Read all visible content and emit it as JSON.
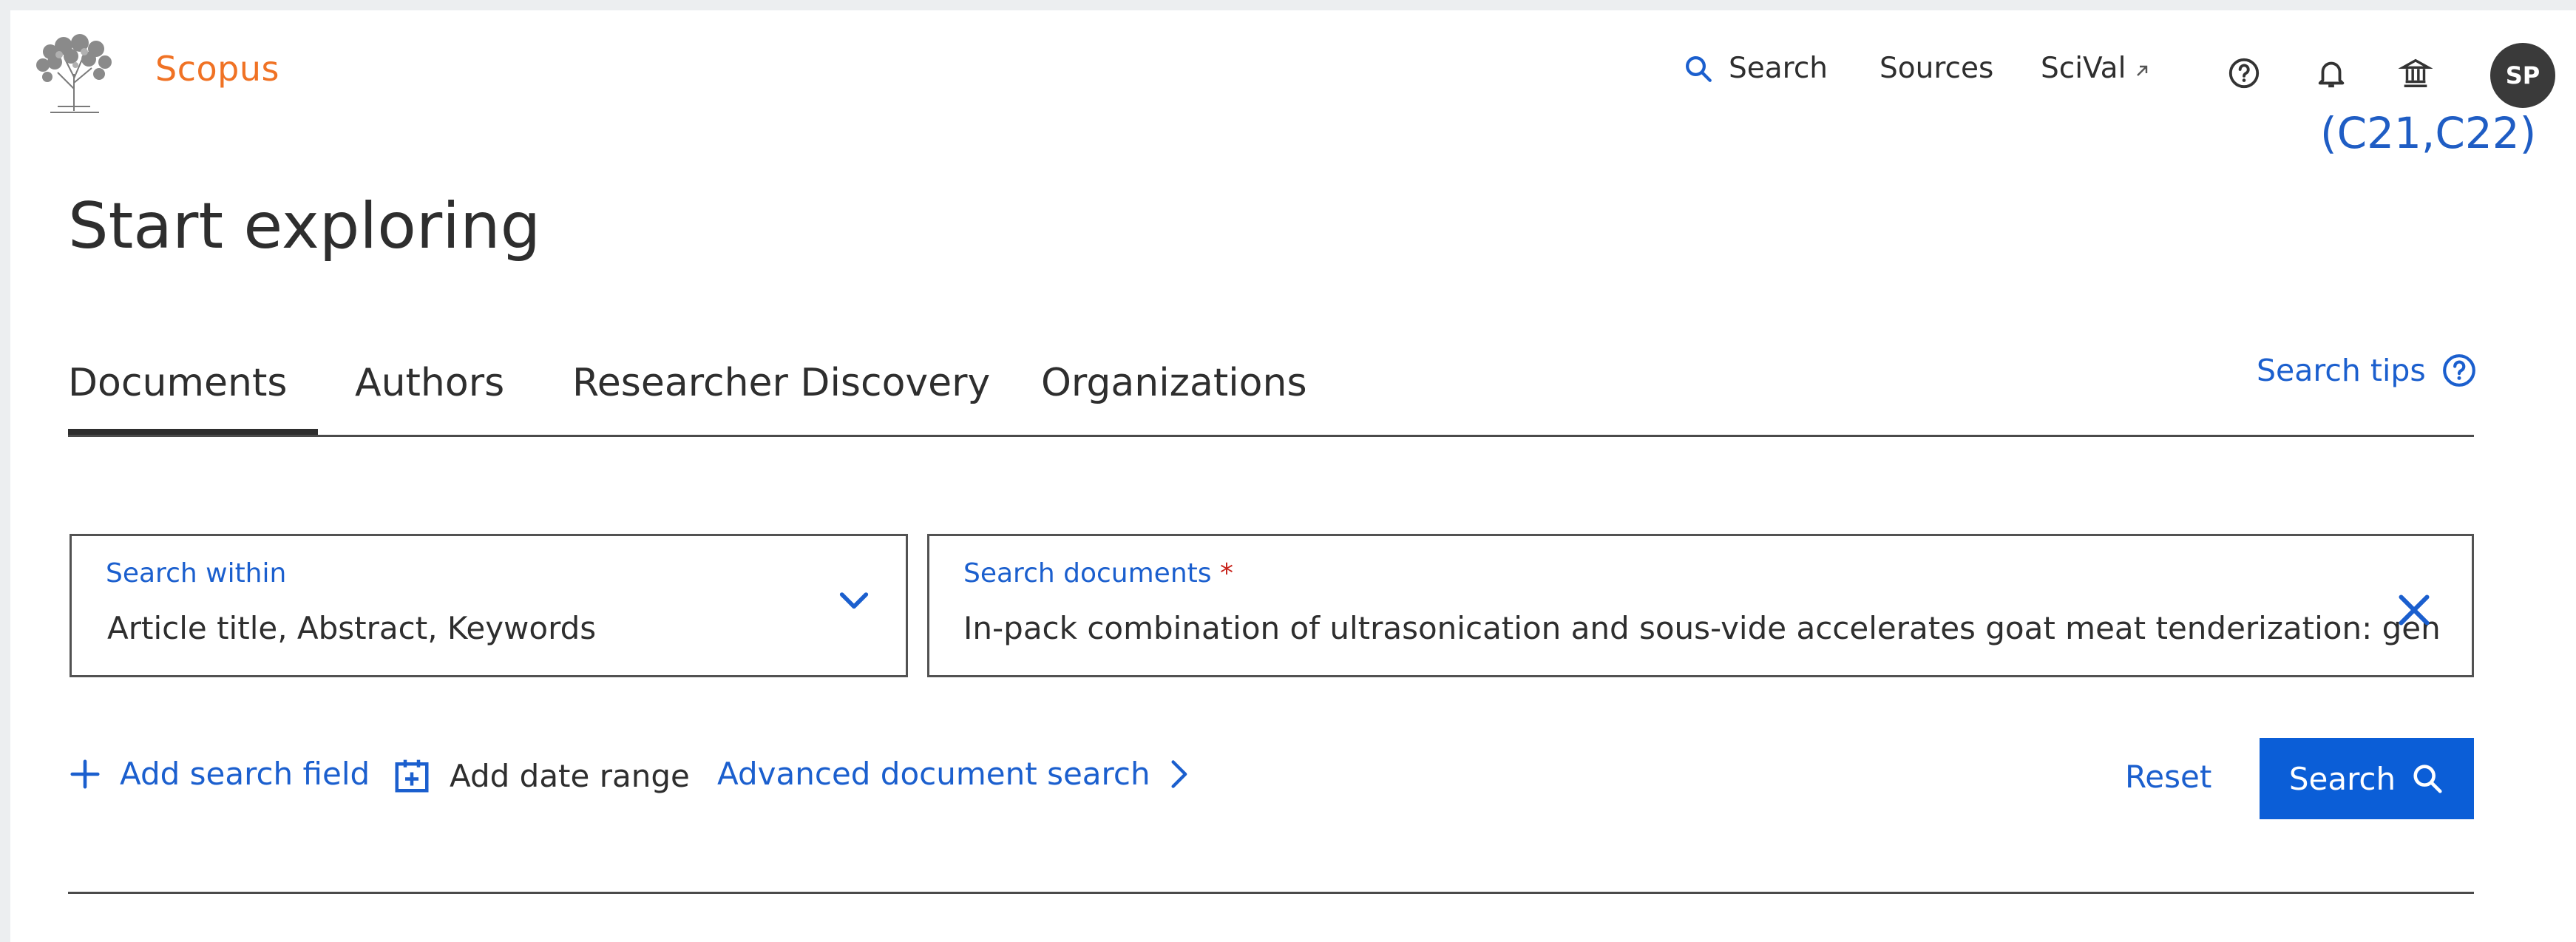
{
  "header": {
    "brand": "Scopus",
    "nav": {
      "search": "Search",
      "sources": "Sources",
      "scival": "SciVal"
    },
    "avatar_initials": "SP",
    "annotation": "(C21,C22)"
  },
  "page_title": "Start exploring",
  "tabs": [
    {
      "label": "Documents",
      "active": true
    },
    {
      "label": "Authors",
      "active": false
    },
    {
      "label": "Researcher Discovery",
      "active": false
    },
    {
      "label": "Organizations",
      "active": false
    }
  ],
  "search_tips": "Search tips",
  "search_within": {
    "label": "Search within",
    "value": "Article title, Abstract, Keywords"
  },
  "search_documents": {
    "label": "Search documents",
    "required_mark": "*",
    "value": "In-pack combination of ultrasonication and sous-vide accelerates goat meat tenderization: gene exp"
  },
  "actions": {
    "add_search_field": "Add search field",
    "add_date_range": "Add date range",
    "advanced_search": "Advanced document search",
    "reset": "Reset",
    "search": "Search"
  },
  "icons": [
    "logo-tree-icon",
    "search-icon",
    "external-link-icon",
    "help-icon",
    "bell-icon",
    "institution-icon",
    "chevron-down-icon",
    "close-icon",
    "plus-icon",
    "calendar-add-icon",
    "chevron-right-icon"
  ],
  "colors": {
    "brand": "#f07224",
    "link": "#1b5fce",
    "primary_button": "#0b5ed7",
    "annotation": "#1f5dc4"
  }
}
